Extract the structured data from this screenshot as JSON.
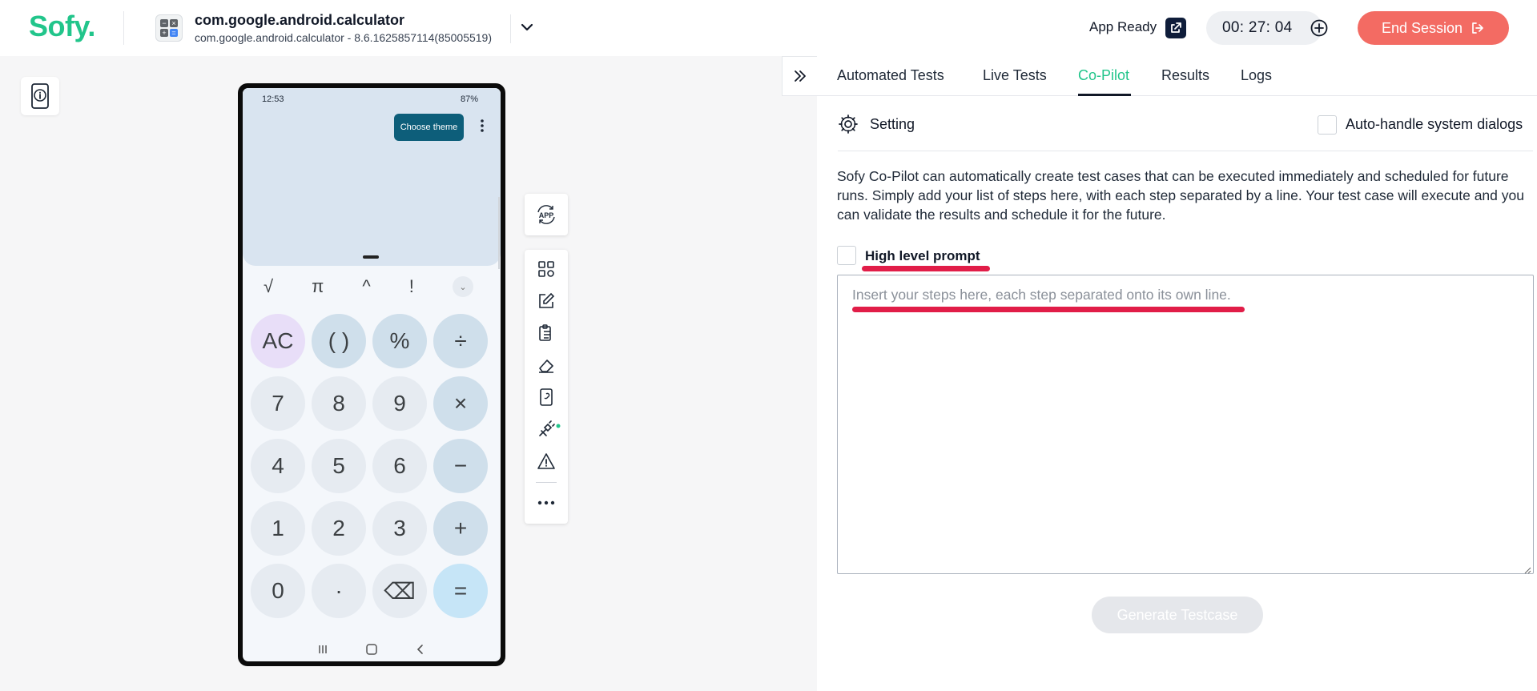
{
  "brand": {
    "logo_text": "Sofy.",
    "color": "#22c58b"
  },
  "app": {
    "name": "com.google.android.calculator",
    "details": "com.google.android.calculator - 8.6.1625857114(85005519)",
    "icon": "calculator-app-icon"
  },
  "session": {
    "status": "App Ready",
    "timer": "00: 27: 04",
    "end_label": "End Session",
    "end_color": "#f36b63"
  },
  "device": {
    "status_bar": {
      "time": "12:53",
      "battery": "87%"
    },
    "theme_tooltip": "Choose theme",
    "scientific_keys": [
      "√",
      "π",
      "^",
      "!"
    ],
    "keypad": [
      [
        "AC",
        "( )",
        "%",
        "÷"
      ],
      [
        "7",
        "8",
        "9",
        "×"
      ],
      [
        "4",
        "5",
        "6",
        "−"
      ],
      [
        "1",
        "2",
        "3",
        "+"
      ],
      [
        "0",
        "·",
        "⌫",
        "="
      ]
    ],
    "nav_icons": [
      "recents-icon",
      "home-icon",
      "back-icon"
    ]
  },
  "toolbar": {
    "app_button_text": "APP",
    "items": [
      "grid-icon",
      "edit-icon",
      "clipboard-icon",
      "eraser-icon",
      "device-link-icon",
      "run-icon",
      "warning-icon",
      "more-icon"
    ]
  },
  "tabs": [
    {
      "label": "Automated Tests",
      "active": false
    },
    {
      "label": "Live Tests",
      "active": false
    },
    {
      "label": "Co-Pilot",
      "active": true
    },
    {
      "label": "Results",
      "active": false
    },
    {
      "label": "Logs",
      "active": false
    }
  ],
  "copilot": {
    "setting_label": "Setting",
    "auto_handle_label": "Auto-handle system dialogs",
    "description": "Sofy Co-Pilot can automatically create test cases that can be executed immediately and scheduled for future runs. Simply add your list of steps here, with each step separated by a line. Your test case will execute and you can validate the results and schedule it for the future.",
    "high_level_prompt_label": "High level prompt",
    "steps_placeholder": "Insert your steps here, each step separated onto its own line.",
    "generate_label": "Generate Testcase"
  }
}
